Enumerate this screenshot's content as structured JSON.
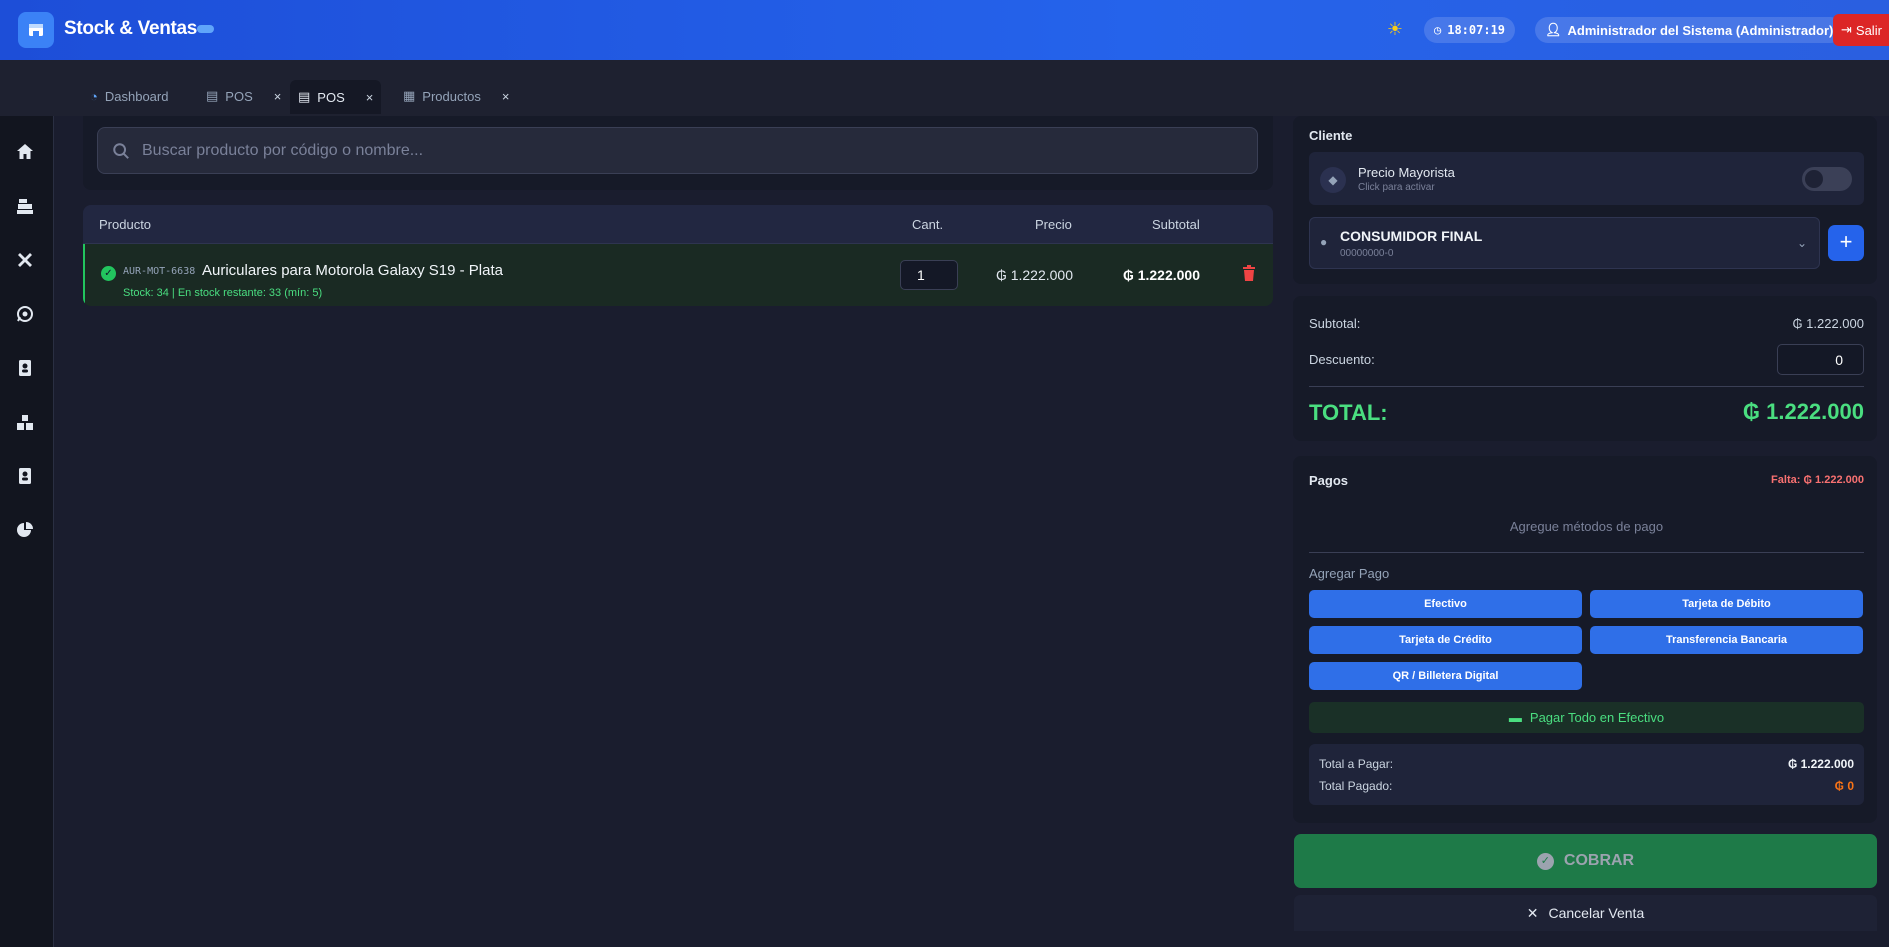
{
  "header": {
    "title": "Stock & Ventas",
    "clock": "18:07:19",
    "user": "Administrador del Sistema (Administrador)",
    "logout_label": "Salir"
  },
  "tabs": [
    {
      "label": "Dashboard",
      "icon": "dashboard-icon",
      "closable": false,
      "active": false
    },
    {
      "label": "POS",
      "icon": "register-icon",
      "closable": true,
      "active": false
    },
    {
      "label": "POS",
      "icon": "register-icon",
      "closable": true,
      "active": true
    },
    {
      "label": "Productos",
      "icon": "box-icon",
      "closable": true,
      "active": false
    }
  ],
  "sidebar": {
    "items": [
      "home-icon",
      "cash-register-icon",
      "tools-icon",
      "whatsapp-icon",
      "contacts-icon",
      "inventory-icon",
      "address-book-icon",
      "reports-pie-icon"
    ]
  },
  "search": {
    "placeholder": "Buscar producto por código o nombre..."
  },
  "cart": {
    "columns": {
      "product": "Producto",
      "qty": "Cant.",
      "price": "Precio",
      "subtotal": "Subtotal"
    },
    "items": [
      {
        "sku": "AUR-MOT-6638",
        "name": "Auriculares para Motorola Galaxy S19 - Plata",
        "stock_info": "Stock: 34 | En stock restante: 33 (mín: 5)",
        "qty": "1",
        "price": "₲ 1.222.000",
        "subtotal": "₲ 1.222.000"
      }
    ]
  },
  "client": {
    "title": "Cliente",
    "wholesale_title": "Precio Mayorista",
    "wholesale_sub": "Click para activar",
    "wholesale_enabled": false,
    "name": "CONSUMIDOR FINAL",
    "doc": "00000000-0",
    "add_label": "+"
  },
  "totals": {
    "subtotal_label": "Subtotal:",
    "subtotal_value": "₲ 1.222.000",
    "discount_label": "Descuento:",
    "discount_value": "0",
    "total_label": "TOTAL:",
    "total_value": "₲ 1.222.000"
  },
  "payments": {
    "title": "Pagos",
    "missing": "Falta: ₲ 1.222.000",
    "empty": "Agregue métodos de pago",
    "add_label": "Agregar Pago",
    "methods": [
      "Efectivo",
      "Tarjeta de Débito",
      "Tarjeta de Crédito",
      "Transferencia Bancaria",
      "QR / Billetera Digital"
    ],
    "pay_all_label": "Pagar Todo en Efectivo",
    "to_pay_label": "Total a Pagar:",
    "to_pay_value": "₲ 1.222.000",
    "paid_label": "Total Pagado:",
    "paid_value": "₲ 0"
  },
  "actions": {
    "charge_label": "COBRAR",
    "cancel_label": "Cancelar Venta"
  },
  "colors": {
    "brand_blue": "#2563eb",
    "success_green": "#4ade80",
    "danger_red": "#ef4444",
    "warning_orange": "#f97316"
  }
}
